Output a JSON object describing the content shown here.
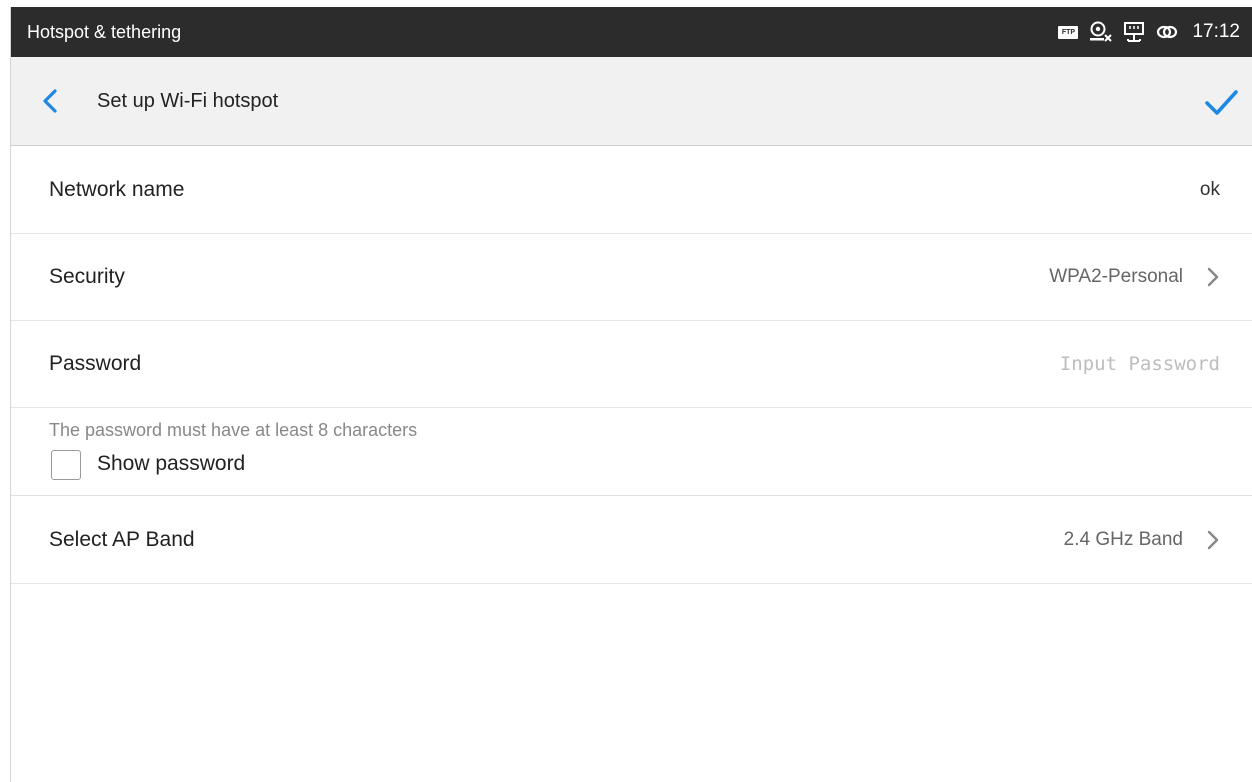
{
  "statusbar": {
    "title": "Hotspot & tethering",
    "icons": [
      "ftp-icon",
      "webcam-off-icon",
      "ethernet-icon",
      "link-icon"
    ],
    "ftp_badge": "FTP",
    "time": "17:12"
  },
  "toolbar": {
    "title": "Set up Wi-Fi hotspot",
    "accent_color": "#1e88e5"
  },
  "settings": {
    "network_name": {
      "label": "Network name",
      "value": "ok"
    },
    "security": {
      "label": "Security",
      "value": "WPA2-Personal"
    },
    "password": {
      "label": "Password",
      "placeholder": "Input Password",
      "value": ""
    },
    "password_hint": "The password must have at least 8 characters",
    "show_password": {
      "label": "Show password",
      "checked": false
    },
    "ap_band": {
      "label": "Select AP Band",
      "value": "2.4 GHz Band"
    }
  }
}
